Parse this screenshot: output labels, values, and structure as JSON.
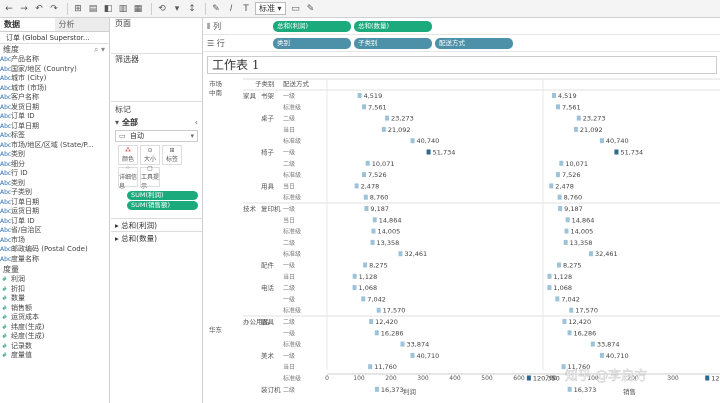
{
  "toolbar": {
    "items": [
      "←",
      "→",
      "↶",
      "↷",
      "⊞",
      "▤",
      "◧",
      "▥",
      "▦",
      "⟲",
      "▾",
      "↕",
      "✎",
      "𝑙",
      "T",
      "▭",
      "✎"
    ],
    "fit": "标准"
  },
  "left": {
    "tabs": [
      "数据",
      "分析"
    ],
    "datasource": "订单 (Global Superstor...",
    "dimensions_header": "维度",
    "dimensions": [
      "产品名称",
      "国家/地区 (Country)",
      "城市 (City)",
      "城市 (市场)",
      "客户名称",
      "发货日期",
      "订单 ID",
      "订单日期",
      "标签",
      "市场/地区/区域 (State/P...",
      "类别",
      "细分",
      "行 ID",
      "类别",
      "子类别",
      "订单日期",
      "运货日期",
      "订单 ID",
      "省/自治区",
      "市场",
      "邮政编码 (Postal Code)",
      "度量名称"
    ],
    "measures_header": "度量",
    "measures": [
      "利润",
      "折扣",
      "数量",
      "销售额",
      "运货成本",
      "纬度(生成)",
      "经度(生成)",
      "记录数",
      "度量值"
    ]
  },
  "mid": {
    "pages": "页面",
    "filters": "筛选器",
    "marks": "标记",
    "all": "全部",
    "mark_type": "自动",
    "buttons": [
      "颜色",
      "大小",
      "标签",
      "详细信息",
      "工具提示"
    ],
    "pills": [
      "SUM(利润)",
      "SUM(销售额)"
    ],
    "sections": [
      "总和(利润)",
      "总和(数量)"
    ]
  },
  "shelves": {
    "columns_label": "列",
    "rows_label": "行",
    "columns": [
      "总和(利润)",
      "总和(数量)"
    ],
    "rows": [
      "类别",
      "子类别",
      "配送方式"
    ]
  },
  "sheet_title": "工作表 1",
  "header_cols": [
    "市场",
    "子类别",
    "配送方式"
  ],
  "region": "中南",
  "footer_region": "华东",
  "axis": {
    "ticks": [
      "0",
      "100",
      "200",
      "300",
      "400",
      "500",
      "600",
      "700"
    ],
    "title_left": "利润",
    "title_right": "销售"
  },
  "chart_data": {
    "type": "bar",
    "series": [
      {
        "name": "利润",
        "values": [
          4519,
          7561,
          23273,
          21092,
          40740,
          51734,
          10071,
          7526,
          2478,
          8760,
          9187,
          14864,
          14005,
          13358,
          32461,
          8275,
          1128,
          1068,
          7042,
          17570,
          12420,
          16286,
          33874,
          40710,
          11760,
          120350,
          16373
        ]
      },
      {
        "name": "销售额",
        "values": [
          4519,
          7561,
          23273,
          21092,
          40740,
          51734,
          10071,
          7526,
          2478,
          8760,
          9187,
          14864,
          14005,
          13358,
          32461,
          8275,
          1128,
          1068,
          7042,
          17570,
          12420,
          16286,
          33874,
          40710,
          11760,
          120350,
          16373
        ]
      }
    ]
  },
  "rows": [
    {
      "cat": "家具",
      "sub": "书架",
      "ship": "一级",
      "label": "4,519",
      "v": 4519,
      "dark": false
    },
    {
      "cat": "",
      "sub": "",
      "ship": "标准级",
      "label": "7,561",
      "v": 7561,
      "dark": false
    },
    {
      "cat": "",
      "sub": "桌子",
      "ship": "二级",
      "label": "23,273",
      "v": 23273,
      "dark": false
    },
    {
      "cat": "",
      "sub": "",
      "ship": "当日",
      "label": "21,092",
      "v": 21092,
      "dark": false
    },
    {
      "cat": "",
      "sub": "",
      "ship": "标准级",
      "label": "40,740",
      "v": 40740,
      "dark": false
    },
    {
      "cat": "",
      "sub": "椅子",
      "ship": "一级",
      "label": "51,734",
      "v": 51734,
      "dark": true
    },
    {
      "cat": "",
      "sub": "",
      "ship": "二级",
      "label": "10,071",
      "v": 10071,
      "dark": false
    },
    {
      "cat": "",
      "sub": "",
      "ship": "标准级",
      "label": "7,526",
      "v": 7526,
      "dark": false
    },
    {
      "cat": "",
      "sub": "用具",
      "ship": "当日",
      "label": "2,478",
      "v": 2478,
      "dark": false
    },
    {
      "cat": "",
      "sub": "",
      "ship": "标准级",
      "label": "8,760",
      "v": 8760,
      "dark": false
    },
    {
      "cat": "技术",
      "sub": "复印机",
      "ship": "一级",
      "label": "9,187",
      "v": 9187,
      "dark": false
    },
    {
      "cat": "",
      "sub": "",
      "ship": "当日",
      "label": "14,864",
      "v": 14864,
      "dark": false
    },
    {
      "cat": "",
      "sub": "",
      "ship": "标准级",
      "label": "14,005",
      "v": 14005,
      "dark": false
    },
    {
      "cat": "",
      "sub": "",
      "ship": "二级",
      "label": "13,358",
      "v": 13358,
      "dark": false
    },
    {
      "cat": "",
      "sub": "",
      "ship": "标准级",
      "label": "32,461",
      "v": 32461,
      "dark": false
    },
    {
      "cat": "",
      "sub": "配件",
      "ship": "一级",
      "label": "8,275",
      "v": 8275,
      "dark": false
    },
    {
      "cat": "",
      "sub": "",
      "ship": "当日",
      "label": "1,128",
      "v": 1128,
      "dark": false
    },
    {
      "cat": "",
      "sub": "电话",
      "ship": "二级",
      "label": "1,068",
      "v": 1068,
      "dark": false
    },
    {
      "cat": "",
      "sub": "",
      "ship": "一级",
      "label": "7,042",
      "v": 7042,
      "dark": false
    },
    {
      "cat": "",
      "sub": "",
      "ship": "标准级",
      "label": "17,570",
      "v": 17570,
      "dark": false
    },
    {
      "cat": "办公用品",
      "sub": "器具",
      "ship": "二级",
      "label": "12,420",
      "v": 12420,
      "dark": false
    },
    {
      "cat": "",
      "sub": "",
      "ship": "一级",
      "label": "16,286",
      "v": 16286,
      "dark": false
    },
    {
      "cat": "",
      "sub": "",
      "ship": "标准级",
      "label": "33,874",
      "v": 33874,
      "dark": false
    },
    {
      "cat": "",
      "sub": "美术",
      "ship": "一级",
      "label": "40,710",
      "v": 40710,
      "dark": false
    },
    {
      "cat": "",
      "sub": "",
      "ship": "当日",
      "label": "11,760",
      "v": 11760,
      "dark": false
    },
    {
      "cat": "",
      "sub": "",
      "ship": "标准级",
      "label": "120,350",
      "v": 120350,
      "dark": true
    },
    {
      "cat": "",
      "sub": "装订机",
      "ship": "二级",
      "label": "16,373",
      "v": 16373,
      "dark": false
    }
  ],
  "colors": {
    "green": "#1aaa7c",
    "blue": "#4d91a8",
    "mark": "#9cc3d8",
    "mark_dark": "#2b6a8f"
  },
  "watermark": "知乎 @李启方"
}
